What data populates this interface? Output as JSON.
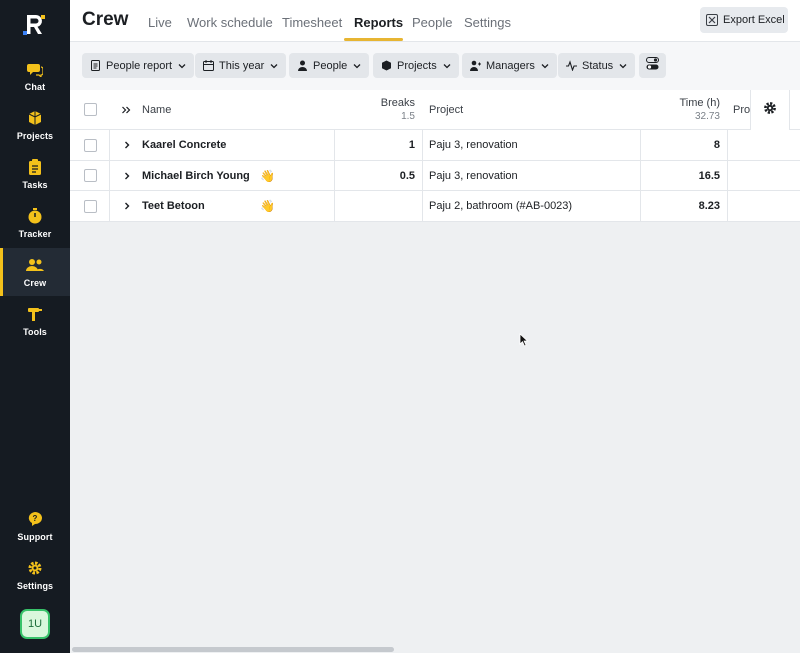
{
  "sidebar": {
    "items": [
      {
        "label": "Chat",
        "icon": "chat-icon"
      },
      {
        "label": "Projects",
        "icon": "projects-icon"
      },
      {
        "label": "Tasks",
        "icon": "tasks-icon"
      },
      {
        "label": "Tracker",
        "icon": "tracker-icon"
      },
      {
        "label": "Crew",
        "icon": "crew-icon",
        "active": true
      },
      {
        "label": "Tools",
        "icon": "tools-icon"
      }
    ],
    "bottom": [
      {
        "label": "Support",
        "icon": "support-icon"
      },
      {
        "label": "Settings",
        "icon": "settings-icon"
      }
    ],
    "avatar": "1U",
    "accent": "#f3c11b"
  },
  "header": {
    "title": "Crew",
    "tabs": [
      "Live",
      "Work schedule",
      "Timesheet",
      "Reports",
      "People",
      "Settings"
    ],
    "active_tab": "Reports",
    "export_label": "Export Excel"
  },
  "toolbar": {
    "filters": [
      {
        "label": "People report",
        "icon": "report-icon"
      },
      {
        "label": "This year",
        "icon": "calendar-icon"
      },
      {
        "label": "People",
        "icon": "person-icon"
      },
      {
        "label": "Projects",
        "icon": "projects-icon"
      },
      {
        "label": "Managers",
        "icon": "managers-icon"
      },
      {
        "label": "Status",
        "icon": "status-icon"
      }
    ]
  },
  "table": {
    "columns": {
      "name": "Name",
      "breaks": "Breaks",
      "breaks_total": "1.5",
      "project": "Project",
      "time": "Time (h)",
      "time_total": "32.73",
      "project_extra": "Pro"
    },
    "rows": [
      {
        "name": "Kaarel Concrete",
        "wave": false,
        "breaks": "1",
        "project": "Paju 3, renovation",
        "time": "8"
      },
      {
        "name": "Michael Birch Young",
        "wave": true,
        "breaks": "0.5",
        "project": "Paju 3, renovation",
        "time": "16.5"
      },
      {
        "name": "Teet Betoon",
        "wave": true,
        "breaks": "",
        "project": "Paju 2, bathroom (#AB-0023)",
        "time": "8.23"
      }
    ]
  },
  "wave_glyph": "👋"
}
